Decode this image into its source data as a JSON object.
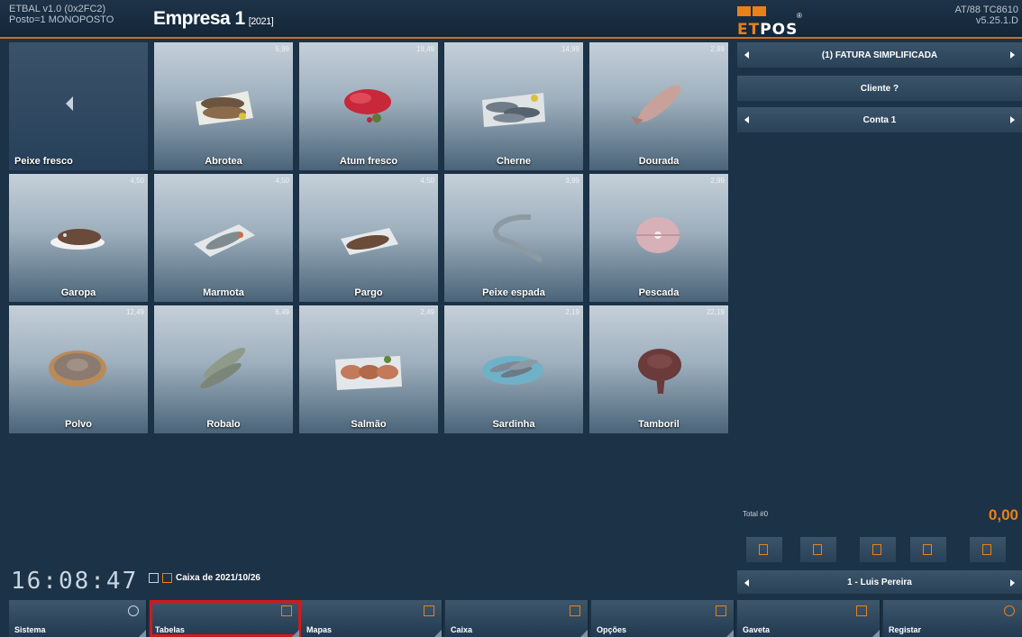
{
  "header": {
    "app_line1": "ETBAL v1.0 (0x2FC2)",
    "app_line2": "Posto=1 MONOPOSTO",
    "company": "Empresa 1",
    "year": "[2021]",
    "logo_text": "ETPOS",
    "version_line1": "AT/88 TC8610",
    "version_line2": "v5.25.1.D"
  },
  "category": {
    "label": "Peixe fresco",
    "back_icon": "chevron-left-icon"
  },
  "products": [
    {
      "name": "Abrotea",
      "price": "5,99"
    },
    {
      "name": "Atum fresco",
      "price": "19,49"
    },
    {
      "name": "Cherne",
      "price": "14,99"
    },
    {
      "name": "Dourada",
      "price": "2,99"
    },
    {
      "name": "Garopa",
      "price": "4,50"
    },
    {
      "name": "Marmota",
      "price": "4,50"
    },
    {
      "name": "Pargo",
      "price": "4,50"
    },
    {
      "name": "Peixe espada",
      "price": "3,99"
    },
    {
      "name": "Pescada",
      "price": "2,99"
    },
    {
      "name": "Polvo",
      "price": "12,49"
    },
    {
      "name": "Robalo",
      "price": "6,49"
    },
    {
      "name": "Salmão",
      "price": "2,49"
    },
    {
      "name": "Sardinha",
      "price": "2,19"
    },
    {
      "name": "Tamboril",
      "price": "22,19"
    }
  ],
  "status": {
    "clock": "16:08:47",
    "caixa": "Caixa de 2021/10/26"
  },
  "bottom_buttons": {
    "sistema": "Sistema",
    "tabelas": "Tabelas",
    "mapas": "Mapas",
    "caixa": "Caixa",
    "opcoes": "Opções",
    "gaveta": "Gaveta",
    "registar": "Registar"
  },
  "document": {
    "type": "(1) FATURA SIMPLIFICADA",
    "client": "Cliente ?",
    "account": "Conta 1",
    "total_label": "Total #0",
    "total_value": "0,00",
    "operator": "1 - Luis Pereira"
  },
  "colors": {
    "accent": "#e8811a",
    "background": "#1c3247",
    "highlight": "#d11a1a"
  }
}
